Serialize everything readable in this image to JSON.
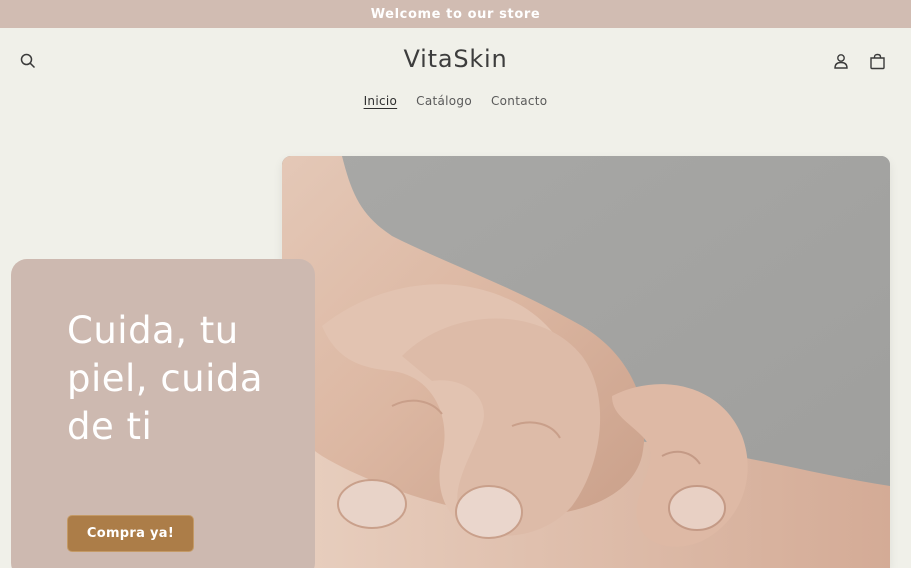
{
  "announcement": {
    "text": "Welcome to our store"
  },
  "header": {
    "logo": "VitaSkin",
    "icons": {
      "search": "search-icon",
      "account": "user-icon",
      "cart": "shopping-bag-icon"
    }
  },
  "nav": {
    "items": [
      {
        "label": "Inicio",
        "active": true
      },
      {
        "label": "Catálogo",
        "active": false
      },
      {
        "label": "Contacto",
        "active": false
      }
    ]
  },
  "hero": {
    "heading": "Cuida, tu piel, cuida de ti",
    "button_label": "Compra ya!"
  },
  "colors": {
    "announcement_bg": "#d1bcb2",
    "page_bg": "#f0f0e9",
    "card_bg": "#cdb9b0",
    "button_bg": "#ac7d48"
  }
}
